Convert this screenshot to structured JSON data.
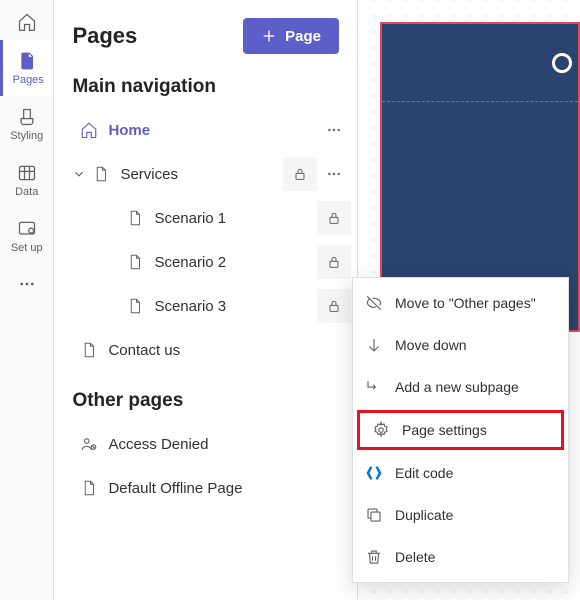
{
  "rail": {
    "items": [
      {
        "label": "Pages"
      },
      {
        "label": "Styling"
      },
      {
        "label": "Data"
      },
      {
        "label": "Set up"
      }
    ]
  },
  "panel": {
    "title": "Pages",
    "newPageBtn": "Page"
  },
  "sections": {
    "main": "Main navigation",
    "other": "Other pages"
  },
  "tree": {
    "home": "Home",
    "services": "Services",
    "scenario1": "Scenario 1",
    "scenario2": "Scenario 2",
    "scenario3": "Scenario 3",
    "contact": "Contact us",
    "accessDenied": "Access Denied",
    "offline": "Default Offline Page"
  },
  "menu": {
    "move": "Move to \"Other pages\"",
    "moveDown": "Move down",
    "addSub": "Add a new subpage",
    "settings": "Page settings",
    "edit": "Edit code",
    "duplicate": "Duplicate",
    "delete": "Delete"
  }
}
